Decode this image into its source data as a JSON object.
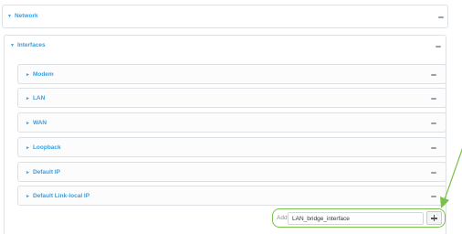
{
  "network": {
    "label": "Network"
  },
  "interfaces": {
    "label": "Interfaces",
    "items": [
      {
        "label": "Modem"
      },
      {
        "label": "LAN"
      },
      {
        "label": "WAN"
      },
      {
        "label": "Loopback"
      },
      {
        "label": "Default IP"
      },
      {
        "label": "Default Link-local IP"
      }
    ]
  },
  "add_interface": {
    "label": "Add",
    "value": "LAN_bridge_interface",
    "button_icon": "plus-icon"
  },
  "colors": {
    "section_label": "#3b9fdc",
    "highlight": "#7ac14a",
    "border": "#e0e3e6"
  }
}
